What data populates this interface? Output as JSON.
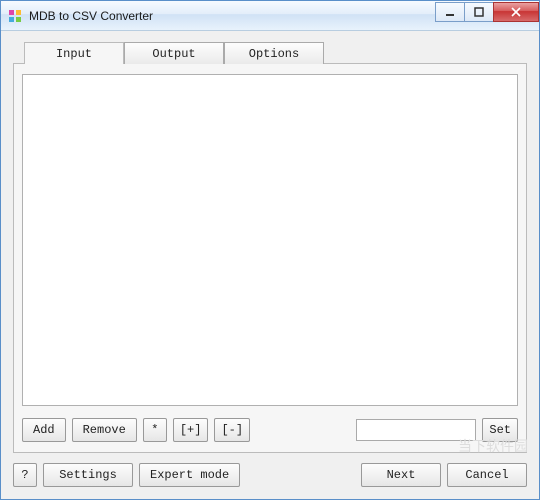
{
  "titlebar": {
    "title": "MDB to CSV Converter"
  },
  "tabs": {
    "input": "Input",
    "output": "Output",
    "options": "Options"
  },
  "toolbar": {
    "add": "Add",
    "remove": "Remove",
    "star": "*",
    "expand": "[+]",
    "collapse": "[-]",
    "filter_value": "",
    "set": "Set"
  },
  "bottom": {
    "help": "?",
    "settings": "Settings",
    "expert": "Expert mode",
    "next": "Next",
    "cancel": "Cancel"
  },
  "watermark": "当下软件园"
}
